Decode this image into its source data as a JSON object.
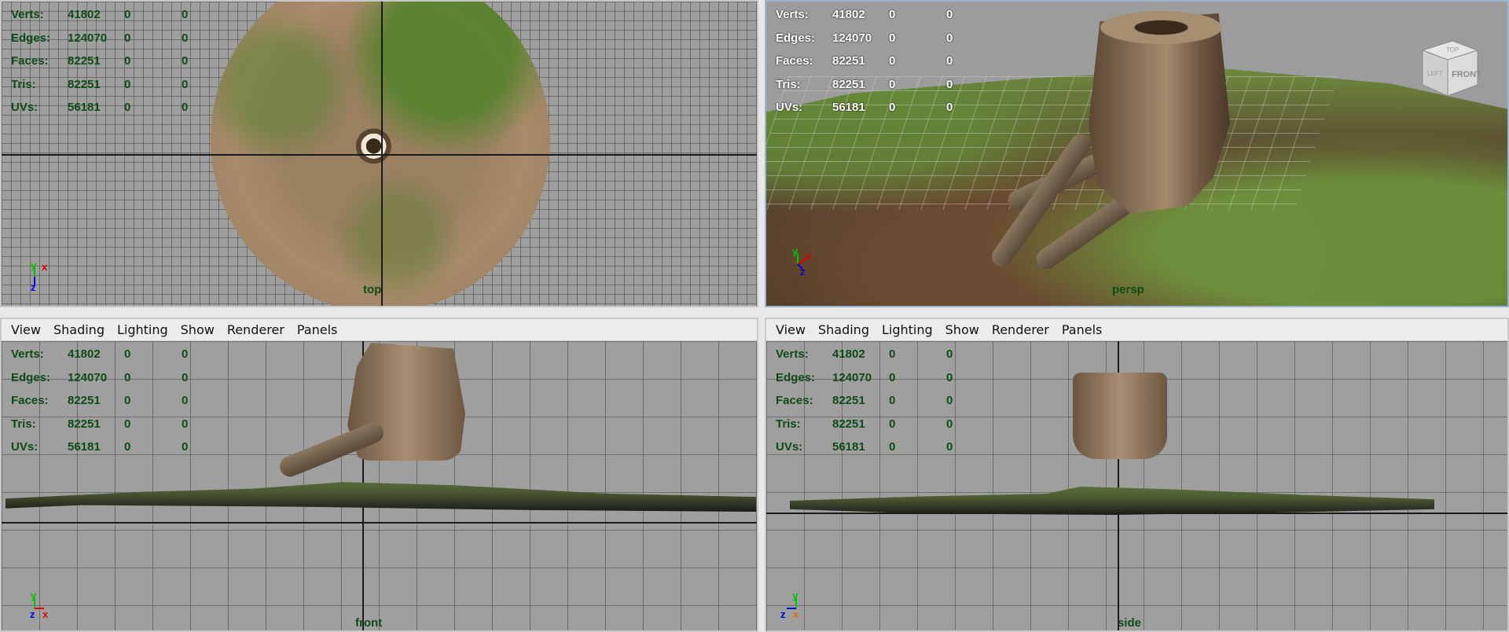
{
  "menu": [
    "View",
    "Shading",
    "Lighting",
    "Show",
    "Renderer",
    "Panels"
  ],
  "stats": [
    {
      "label": "Verts:",
      "v1": "41802",
      "v2": "0",
      "v3": "0"
    },
    {
      "label": "Edges:",
      "v1": "124070",
      "v2": "0",
      "v3": "0"
    },
    {
      "label": "Faces:",
      "v1": "82251",
      "v2": "0",
      "v3": "0"
    },
    {
      "label": "Tris:",
      "v1": "82251",
      "v2": "0",
      "v3": "0"
    },
    {
      "label": "UVs:",
      "v1": "56181",
      "v2": "0",
      "v3": "0"
    }
  ],
  "cameras": {
    "top": "top",
    "persp": "persp",
    "front": "front",
    "side": "side"
  },
  "viewcube": {
    "top": "TOP",
    "left": "LEFT",
    "front": "FRONT"
  },
  "axes": {
    "x": "x",
    "y": "y",
    "z": "z"
  },
  "colors": {
    "hud": "#0e4b16",
    "axis_x": "#e00000",
    "axis_y": "#00c000",
    "axis_z": "#0000e0",
    "viewport": "#9f9f9f"
  }
}
